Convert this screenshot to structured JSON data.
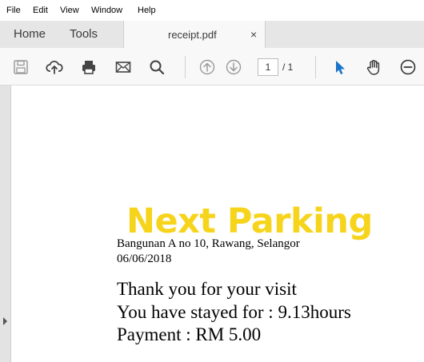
{
  "menu": {
    "file": "File",
    "edit": "Edit",
    "view": "View",
    "window": "Window",
    "help": "Help"
  },
  "tabs": {
    "home": "Home",
    "tools": "Tools",
    "document": "receipt.pdf",
    "close": "×"
  },
  "toolbar": {
    "page_current": "1",
    "page_total": "/ 1"
  },
  "receipt": {
    "brand": "Next Parking",
    "address": "Bangunan A no 10, Rawang, Selangor",
    "date": "06/06/2018",
    "thanks": "Thank you for your visit",
    "stay": "You have stayed for : 9.13hours",
    "payment": "Payment : RM 5.00"
  },
  "colors": {
    "brand_yellow": "#f7d41c",
    "select_tool_blue": "#1a73c9",
    "icon_gray": "#8a8a8a",
    "icon_dark": "#444444"
  },
  "icons": [
    "save-icon",
    "cloud-upload-icon",
    "print-icon",
    "email-icon",
    "search-icon",
    "page-up-icon",
    "page-down-icon",
    "select-cursor-icon",
    "hand-tool-icon",
    "zoom-out-icon"
  ]
}
